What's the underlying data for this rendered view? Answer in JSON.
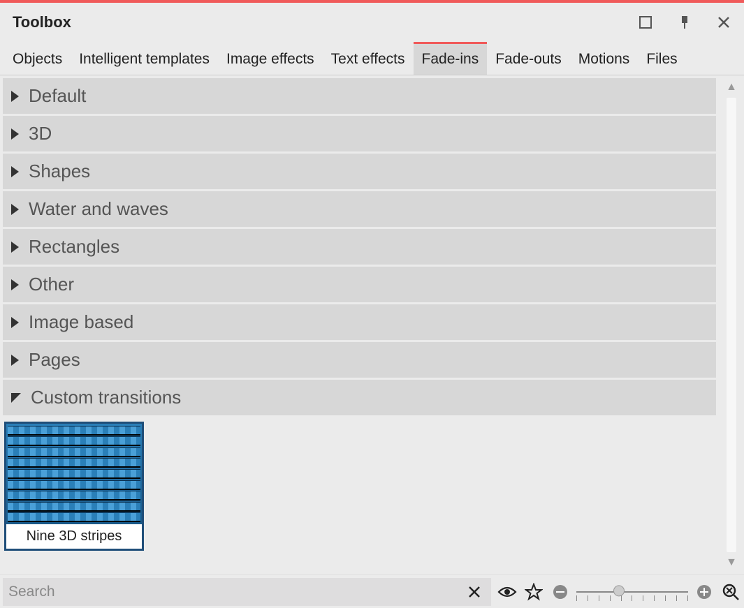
{
  "window": {
    "title": "Toolbox"
  },
  "tabs": [
    {
      "label": "Objects",
      "active": false
    },
    {
      "label": "Intelligent templates",
      "active": false
    },
    {
      "label": "Image effects",
      "active": false
    },
    {
      "label": "Text effects",
      "active": false
    },
    {
      "label": "Fade-ins",
      "active": true
    },
    {
      "label": "Fade-outs",
      "active": false
    },
    {
      "label": "Motions",
      "active": false
    },
    {
      "label": "Files",
      "active": false
    }
  ],
  "groups": [
    {
      "label": "Default",
      "expanded": false
    },
    {
      "label": "3D",
      "expanded": false
    },
    {
      "label": "Shapes",
      "expanded": false
    },
    {
      "label": "Water and waves",
      "expanded": false
    },
    {
      "label": "Rectangles",
      "expanded": false
    },
    {
      "label": "Other",
      "expanded": false
    },
    {
      "label": "Image based",
      "expanded": false
    },
    {
      "label": "Pages",
      "expanded": false
    },
    {
      "label": "Custom transitions",
      "expanded": true
    }
  ],
  "custom_transitions_items": [
    {
      "caption": "Nine 3D stripes",
      "selected": true
    }
  ],
  "search": {
    "placeholder": "Search",
    "value": ""
  }
}
